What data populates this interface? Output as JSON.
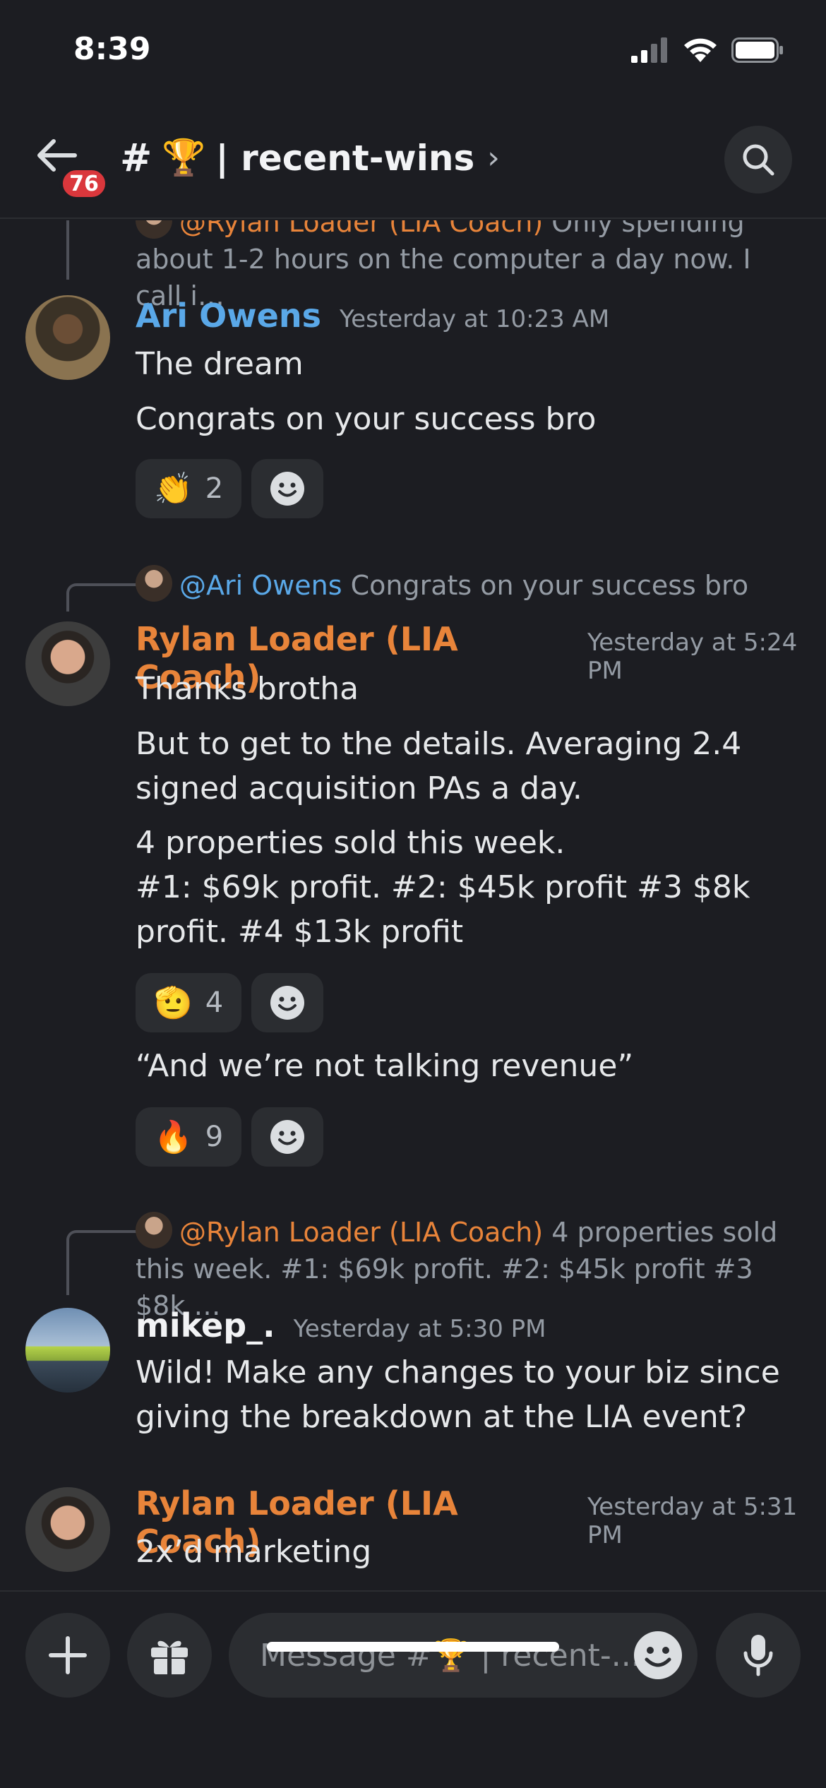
{
  "status": {
    "time": "8:39"
  },
  "header": {
    "unread_badge": "76",
    "channel_hash": "#",
    "channel_emoji": "🏆",
    "channel_name": "| recent-wins",
    "chevron": "›"
  },
  "messages": [
    {
      "reply": {
        "mention": "@Rylan Loader (LIA Coach)",
        "snippet": " Only spending about 1-2 hours on the computer a day now. I call i…"
      }
    },
    {
      "author": "Ari Owens",
      "timestamp": "Yesterday at 10:23 AM",
      "lines": [
        "The dream",
        "Congrats on your success bro"
      ],
      "reactions": [
        {
          "emoji": "👏",
          "count": "2"
        }
      ]
    },
    {
      "reply": {
        "mention": "@Ari Owens",
        "snippet": " Congrats on your success bro"
      },
      "author": "Rylan Loader (LIA Coach)",
      "timestamp": "Yesterday at 5:24 PM",
      "lines": [
        "Thanks brotha",
        "But to get to the details. Averaging 2.4 signed acquisition PAs a day.",
        "4 properties sold this week.\n#1: $69k profit.    #2: $45k profit #3 $8k profit.   #4  $13k profit",
        "“And we’re not talking revenue”"
      ],
      "reactions": [
        {
          "emoji": "🫡",
          "count": "4"
        },
        {
          "emoji": "🔥",
          "count": "9"
        }
      ]
    },
    {
      "reply": {
        "mention": "@Rylan Loader (LIA Coach)",
        "snippet": " 4 properties sold this week. #1: $69k profit.    #2: $45k profit #3 $8k …"
      },
      "author": "mikep_.",
      "timestamp": "Yesterday at 5:30 PM",
      "lines": [
        "Wild! Make any changes to your biz since giving the breakdown at the LIA event?"
      ]
    },
    {
      "author": "Rylan Loader (LIA Coach)",
      "timestamp": "Yesterday at 5:31 PM",
      "lines": [
        "2x’d marketing"
      ]
    }
  ],
  "composer": {
    "placeholder": "Message #🏆 | recent-..."
  },
  "colors": {
    "background": "#1c1d22",
    "surface": "#2b2d31",
    "accent_blue": "#5aa8e8",
    "accent_orange": "#e8843a",
    "badge_red": "#da373c"
  },
  "icons": [
    "back-arrow-icon",
    "search-icon",
    "plus-icon",
    "gift-icon",
    "smiley-icon",
    "microphone-icon",
    "signal-icon",
    "wifi-icon",
    "battery-icon"
  ]
}
